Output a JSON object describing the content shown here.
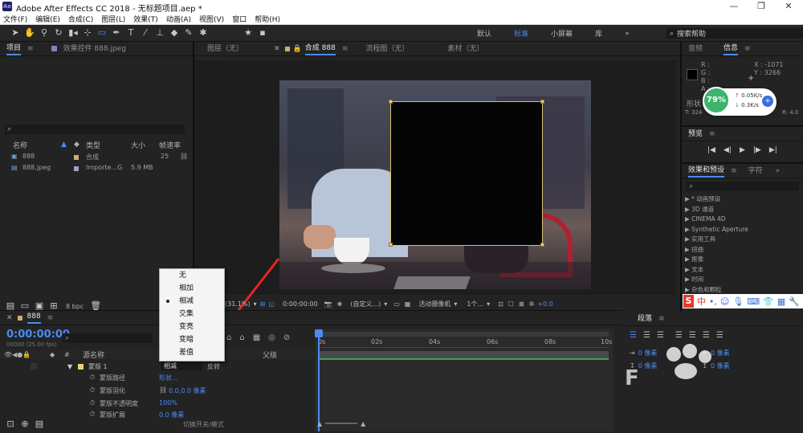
{
  "app": {
    "title": "Adobe After Effects CC 2018 - 无标题项目.aep *",
    "logo": "Ae"
  },
  "menu": [
    "文件(F)",
    "编辑(E)",
    "合成(C)",
    "图层(L)",
    "效果(T)",
    "动画(A)",
    "视图(V)",
    "窗口",
    "帮助(H)"
  ],
  "workspaces": [
    "默认",
    "标准",
    "小屏幕",
    "库"
  ],
  "active_workspace": "标准",
  "search_help": "搜索帮助",
  "project_panel": {
    "tab": "项目",
    "effect_controls_tab": "效果控件 888.jpeg",
    "columns": [
      "名称",
      "类型",
      "大小",
      "帧速率"
    ],
    "items": [
      {
        "name": "888",
        "type": "合成",
        "size": "",
        "fps": "25"
      },
      {
        "name": "888.jpeg",
        "type": "Importe...G",
        "size": "5.9 MB",
        "fps": ""
      }
    ],
    "bpc": "8 bpc"
  },
  "viewer": {
    "tabs": [
      "图层（无）",
      "合成 888",
      "流程图（无）",
      "素材（无）"
    ],
    "comp_label": "888",
    "zoom": "(31.1%)",
    "timecode": "0:00:00:00",
    "resolution": "(自定义...)",
    "camera": "活动摄像机",
    "views": "1个...",
    "exposure": "+0.0"
  },
  "blend_dropdown": {
    "options": [
      "无",
      "相加",
      "相减",
      "交集",
      "变亮",
      "变暗",
      "差值"
    ],
    "selected": "相减"
  },
  "timeline": {
    "comp_tab": "888",
    "timecode": "0:00:00:00",
    "frames": "00000 (25.00 fps)",
    "col_source": "源名称",
    "col_parent": "父级",
    "layer": {
      "num": "1",
      "name": "蒙版 1",
      "mode": "相减",
      "invert": "反转"
    },
    "props": [
      {
        "name": "蒙版路径",
        "value": "形状..."
      },
      {
        "name": "蒙版羽化",
        "value": "0.0,0.0 像素"
      },
      {
        "name": "蒙版不透明度",
        "value": "100%"
      },
      {
        "name": "蒙版扩展",
        "value": "0.0 像素"
      }
    ],
    "ruler": [
      "0s",
      "02s",
      "04s",
      "06s",
      "08s",
      "10s"
    ],
    "footer": "切换开关/模式"
  },
  "info_panel": {
    "tabs": [
      "音频",
      "信息"
    ],
    "r": "R :",
    "g": "G :",
    "b": "B :",
    "a": "A :",
    "x": "X : -1071",
    "y": "Y : 3266",
    "shape_label": "形状",
    "t_label": "T: 324",
    "r_label": "R: 4.0"
  },
  "net_widget": {
    "percent": "79%",
    "up": "0.05K/s",
    "down": "0.3K/s"
  },
  "preview_panel": {
    "tab": "预览"
  },
  "effects_panel": {
    "tabs": [
      "效果和预设",
      "字符"
    ],
    "items": [
      "* 动画预设",
      "3D 通道",
      "CINEMA 4D",
      "Synthetic Aperture",
      "实用工具",
      "扭曲",
      "抠像",
      "文本",
      "时间",
      "杂色和颗粒"
    ]
  },
  "paragraph_panel": {
    "tab": "段落",
    "px1": "0 像素",
    "px2": "0 像素",
    "px3": "0 像素",
    "px4": "0 像素"
  },
  "ime": {
    "label": "中"
  }
}
